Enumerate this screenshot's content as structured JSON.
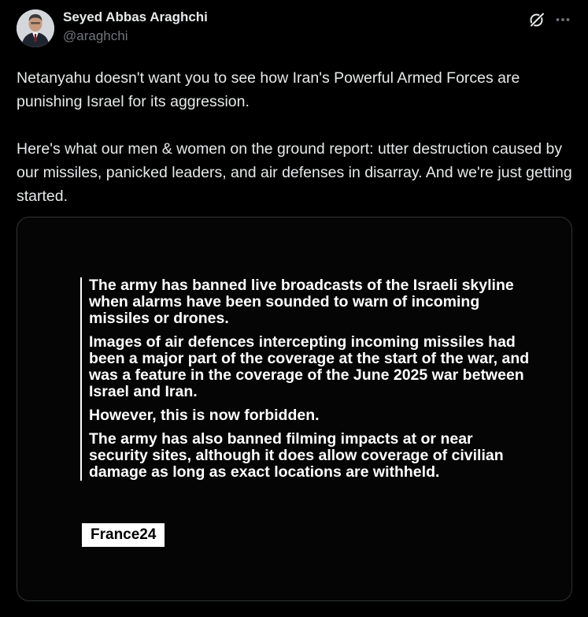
{
  "author": {
    "name": "Seyed Abbas Araghchi",
    "handle": "@araghchi"
  },
  "icons": {
    "grok": "grok-icon",
    "more": "more-horizontal-icon"
  },
  "tweet": {
    "paragraphs": [
      "Netanyahu doesn't want you to see how Iran's Powerful Armed Forces are punishing Israel for its aggression.",
      "Here's what our men & women on the ground report: utter destruction caused by our missiles, panicked leaders, and air defenses in disarray. And we're just getting started."
    ]
  },
  "media": {
    "quote_paragraphs": [
      "The army has banned live broadcasts of the Israeli skyline when alarms have been sounded to warn of incoming missiles or drones.",
      "Images of air defences intercepting incoming missiles had been a major part of the coverage at the start of the war, and was a feature in the coverage of the June 2025 war between Israel and Iran.",
      "However, this is now forbidden.",
      "The army has also banned filming impacts at or near security sites, although it does allow coverage of civilian damage as long as exact locations are withheld."
    ],
    "source_label": "France24"
  },
  "colors": {
    "background": "#000000",
    "primary_text": "#e7e9ea",
    "secondary_text": "#71767b",
    "card_border": "#2f3336",
    "quote_text": "#ffffff",
    "badge_background": "#ffffff",
    "badge_text": "#000000"
  }
}
